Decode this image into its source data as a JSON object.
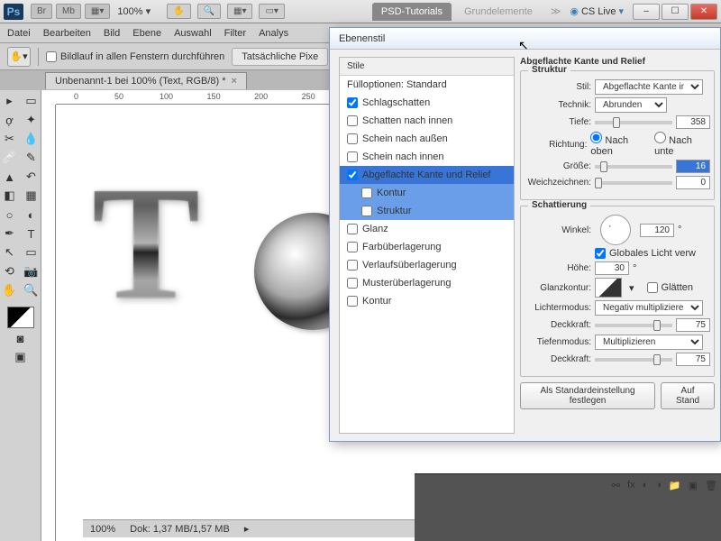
{
  "app": {
    "title": "Ps",
    "zoom": "100%",
    "csLive": "CS Live"
  },
  "topTabs": {
    "active": "PSD-Tutorials",
    "inactive": "Grundelemente"
  },
  "menu": [
    "Datei",
    "Bearbeiten",
    "Bild",
    "Ebene",
    "Auswahl",
    "Filter",
    "Analys"
  ],
  "optbar": {
    "scroll": "Bildlauf in allen Fenstern durchführen",
    "actual": "Tatsächliche Pixe"
  },
  "docTab": "Unbenannt-1 bei 100% (Text, RGB/8) *",
  "status": {
    "zoom": "100%",
    "doc": "Dok: 1,37 MB/1,57 MB"
  },
  "dialog": {
    "title": "Ebenenstil",
    "stylesHeader": "Stile",
    "items": [
      {
        "label": "Fülloptionen: Standard",
        "checked": false,
        "noCheck": true
      },
      {
        "label": "Schlagschatten",
        "checked": true
      },
      {
        "label": "Schatten nach innen",
        "checked": false
      },
      {
        "label": "Schein nach außen",
        "checked": false
      },
      {
        "label": "Schein nach innen",
        "checked": false
      },
      {
        "label": "Abgeflachte Kante und Relief",
        "checked": true,
        "selected": true
      },
      {
        "label": "Kontur",
        "checked": false,
        "sub": true
      },
      {
        "label": "Struktur",
        "checked": false,
        "sub": true
      },
      {
        "label": "Glanz",
        "checked": false
      },
      {
        "label": "Farbüberlagerung",
        "checked": false
      },
      {
        "label": "Verlaufsüberlagerung",
        "checked": false
      },
      {
        "label": "Musterüberlagerung",
        "checked": false
      },
      {
        "label": "Kontur",
        "checked": false
      }
    ],
    "section1": "Abgeflachte Kante und Relief",
    "struktur": "Struktur",
    "stil": {
      "label": "Stil:",
      "value": "Abgeflachte Kante innen"
    },
    "technik": {
      "label": "Technik:",
      "value": "Abrunden"
    },
    "tiefe": {
      "label": "Tiefe:",
      "value": "358"
    },
    "richtung": {
      "label": "Richtung:",
      "up": "Nach oben",
      "down": "Nach unte"
    },
    "groesse": {
      "label": "Größe:",
      "value": "16"
    },
    "weich": {
      "label": "Weichzeichnen:",
      "value": "0"
    },
    "schattierung": "Schattierung",
    "winkel": {
      "label": "Winkel:",
      "value": "120",
      "unit": "°"
    },
    "globLicht": "Globales Licht verw",
    "hoehe": {
      "label": "Höhe:",
      "value": "30",
      "unit": "°"
    },
    "glanzkontur": {
      "label": "Glanzkontur:",
      "glaetten": "Glätten"
    },
    "lichter": {
      "label": "Lichtermodus:",
      "value": "Negativ multiplizieren"
    },
    "deck1": {
      "label": "Deckkraft:",
      "value": "75"
    },
    "tiefm": {
      "label": "Tiefenmodus:",
      "value": "Multiplizieren"
    },
    "deck2": {
      "label": "Deckkraft:",
      "value": "75"
    },
    "btnStd": "Als Standardeinstellung festlegen",
    "btnReset": "Auf Stand"
  }
}
